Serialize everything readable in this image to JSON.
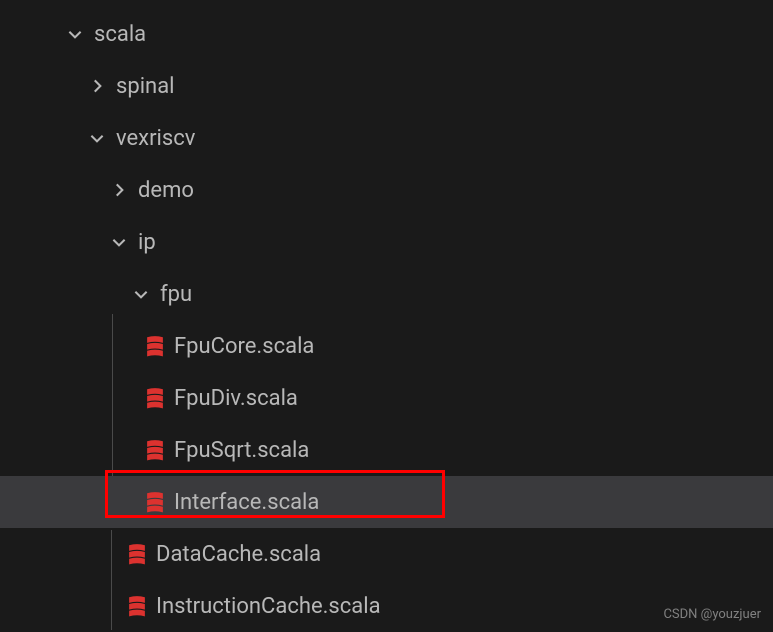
{
  "tree": {
    "scala": "scala",
    "spinal": "spinal",
    "vexriscv": "vexriscv",
    "demo": "demo",
    "ip": "ip",
    "fpu": "fpu",
    "files": {
      "fpucore": "FpuCore.scala",
      "fpudiv": "FpuDiv.scala",
      "fpusqrt": "FpuSqrt.scala",
      "interface": "Interface.scala",
      "datacache": "DataCache.scala",
      "instructioncache": "InstructionCache.scala"
    }
  },
  "watermark": "CSDN @youzjuer"
}
